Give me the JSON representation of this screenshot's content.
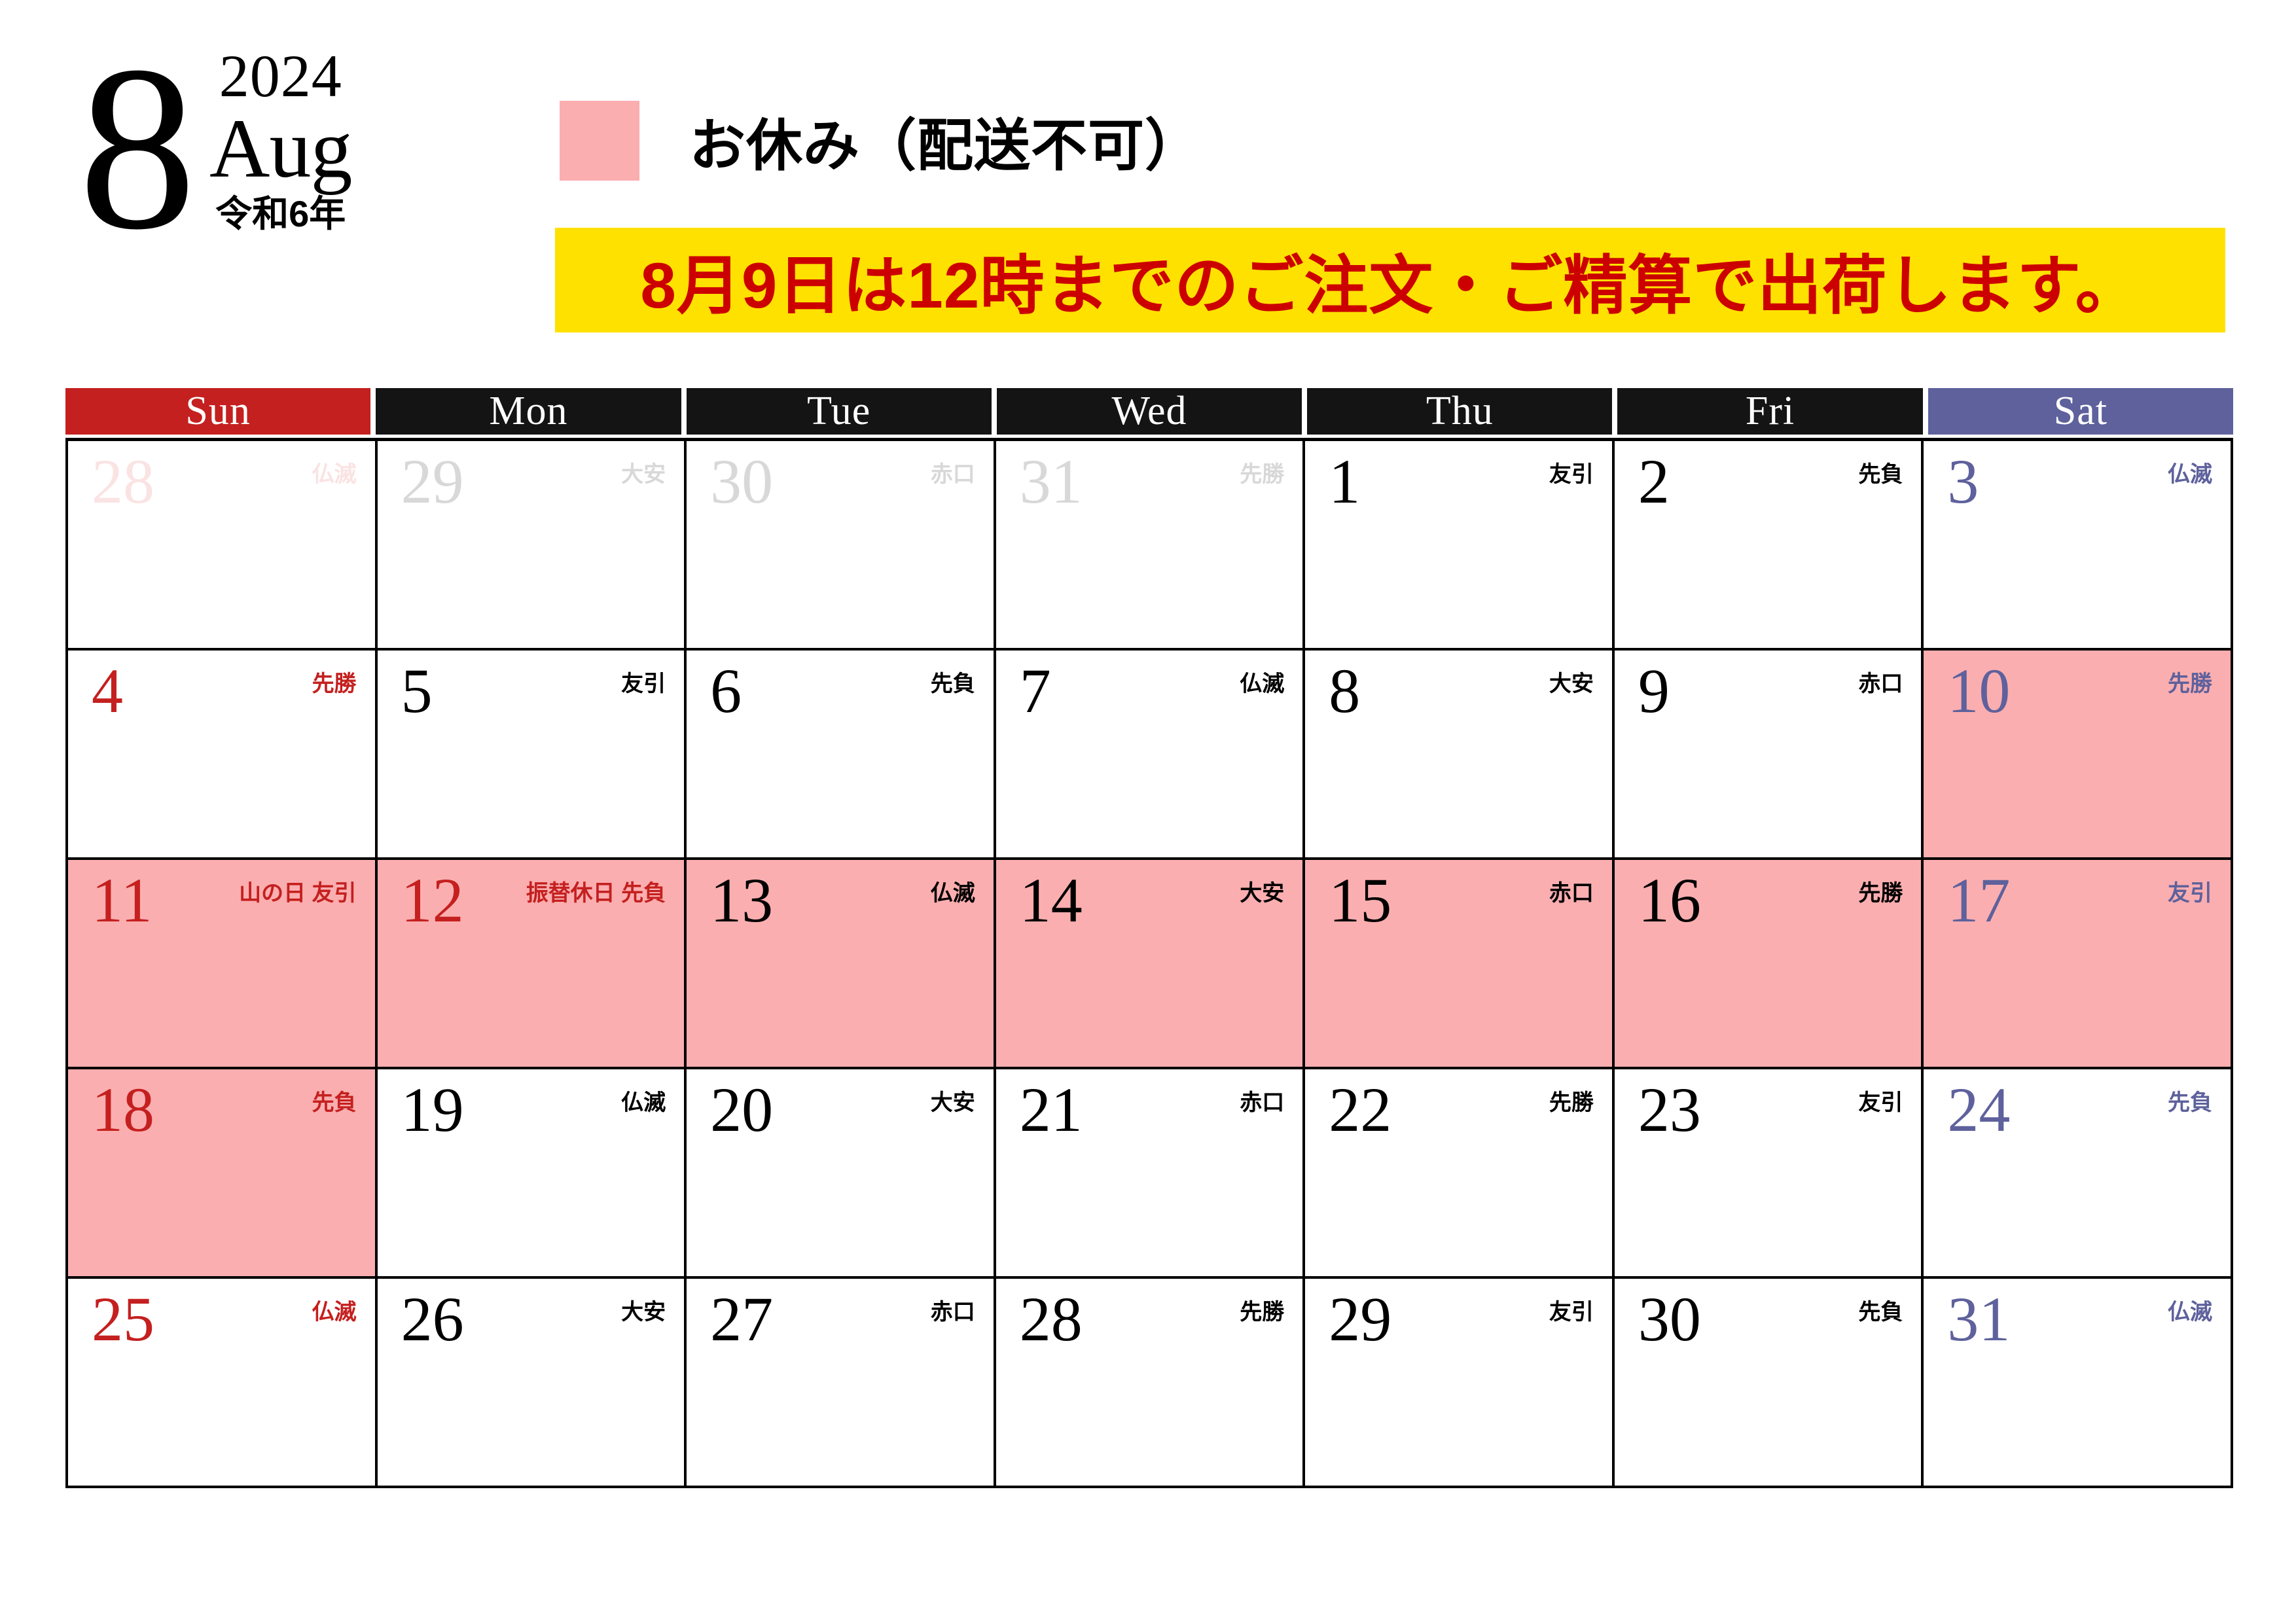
{
  "header": {
    "month_number": "8",
    "year": "2024",
    "month_en": "Aug",
    "era": "令和6年",
    "legend_label": "お休み（配送不可）",
    "banner_text": "8月9日は12時までのご注文・ご精算で出荷します。",
    "legend_color": "#FBAEB0",
    "banner_bg": "#FFE100",
    "banner_fg": "#CC0000"
  },
  "colors": {
    "sunday": "#C4201F",
    "saturday": "#5E619C",
    "weekday": "#000000",
    "holiday_bg": "#FBAEB0",
    "header_sun_bg": "#C4201F",
    "header_week_bg": "#141414",
    "header_sat_bg": "#5E619C"
  },
  "weekdays": [
    "Sun",
    "Mon",
    "Tue",
    "Wed",
    "Thu",
    "Fri",
    "Sat"
  ],
  "weeks": [
    [
      {
        "num": "28",
        "meta": "仏滅",
        "outside": true,
        "tone": "out-sun",
        "holiday": false
      },
      {
        "num": "29",
        "meta": "大安",
        "outside": true,
        "tone": "out-gray",
        "holiday": false
      },
      {
        "num": "30",
        "meta": "赤口",
        "outside": true,
        "tone": "out-gray",
        "holiday": false
      },
      {
        "num": "31",
        "meta": "先勝",
        "outside": true,
        "tone": "out-gray",
        "holiday": false
      },
      {
        "num": "1",
        "meta": "友引",
        "outside": false,
        "tone": "black",
        "holiday": false
      },
      {
        "num": "2",
        "meta": "先負",
        "outside": false,
        "tone": "black",
        "holiday": false
      },
      {
        "num": "3",
        "meta": "仏滅",
        "outside": false,
        "tone": "sat",
        "holiday": false
      }
    ],
    [
      {
        "num": "4",
        "meta": "先勝",
        "outside": false,
        "tone": "sun",
        "holiday": false
      },
      {
        "num": "5",
        "meta": "友引",
        "outside": false,
        "tone": "black",
        "holiday": false
      },
      {
        "num": "6",
        "meta": "先負",
        "outside": false,
        "tone": "black",
        "holiday": false
      },
      {
        "num": "7",
        "meta": "仏滅",
        "outside": false,
        "tone": "black",
        "holiday": false
      },
      {
        "num": "8",
        "meta": "大安",
        "outside": false,
        "tone": "black",
        "holiday": false
      },
      {
        "num": "9",
        "meta": "赤口",
        "outside": false,
        "tone": "black",
        "holiday": false
      },
      {
        "num": "10",
        "meta": "先勝",
        "outside": false,
        "tone": "sat",
        "holiday": true
      }
    ],
    [
      {
        "num": "11",
        "meta": "山の日 友引",
        "outside": false,
        "tone": "sun",
        "holiday": true
      },
      {
        "num": "12",
        "meta": "振替休日 先負",
        "outside": false,
        "tone": "sun",
        "holiday": true
      },
      {
        "num": "13",
        "meta": "仏滅",
        "outside": false,
        "tone": "black",
        "holiday": true
      },
      {
        "num": "14",
        "meta": "大安",
        "outside": false,
        "tone": "black",
        "holiday": true
      },
      {
        "num": "15",
        "meta": "赤口",
        "outside": false,
        "tone": "black",
        "holiday": true
      },
      {
        "num": "16",
        "meta": "先勝",
        "outside": false,
        "tone": "black",
        "holiday": true
      },
      {
        "num": "17",
        "meta": "友引",
        "outside": false,
        "tone": "sat",
        "holiday": true
      }
    ],
    [
      {
        "num": "18",
        "meta": "先負",
        "outside": false,
        "tone": "sun",
        "holiday": true
      },
      {
        "num": "19",
        "meta": "仏滅",
        "outside": false,
        "tone": "black",
        "holiday": false
      },
      {
        "num": "20",
        "meta": "大安",
        "outside": false,
        "tone": "black",
        "holiday": false
      },
      {
        "num": "21",
        "meta": "赤口",
        "outside": false,
        "tone": "black",
        "holiday": false
      },
      {
        "num": "22",
        "meta": "先勝",
        "outside": false,
        "tone": "black",
        "holiday": false
      },
      {
        "num": "23",
        "meta": "友引",
        "outside": false,
        "tone": "black",
        "holiday": false
      },
      {
        "num": "24",
        "meta": "先負",
        "outside": false,
        "tone": "sat",
        "holiday": false
      }
    ],
    [
      {
        "num": "25",
        "meta": "仏滅",
        "outside": false,
        "tone": "sun",
        "holiday": false
      },
      {
        "num": "26",
        "meta": "大安",
        "outside": false,
        "tone": "black",
        "holiday": false
      },
      {
        "num": "27",
        "meta": "赤口",
        "outside": false,
        "tone": "black",
        "holiday": false
      },
      {
        "num": "28",
        "meta": "先勝",
        "outside": false,
        "tone": "black",
        "holiday": false
      },
      {
        "num": "29",
        "meta": "友引",
        "outside": false,
        "tone": "black",
        "holiday": false
      },
      {
        "num": "30",
        "meta": "先負",
        "outside": false,
        "tone": "black",
        "holiday": false
      },
      {
        "num": "31",
        "meta": "仏滅",
        "outside": false,
        "tone": "sat",
        "holiday": false
      }
    ]
  ]
}
